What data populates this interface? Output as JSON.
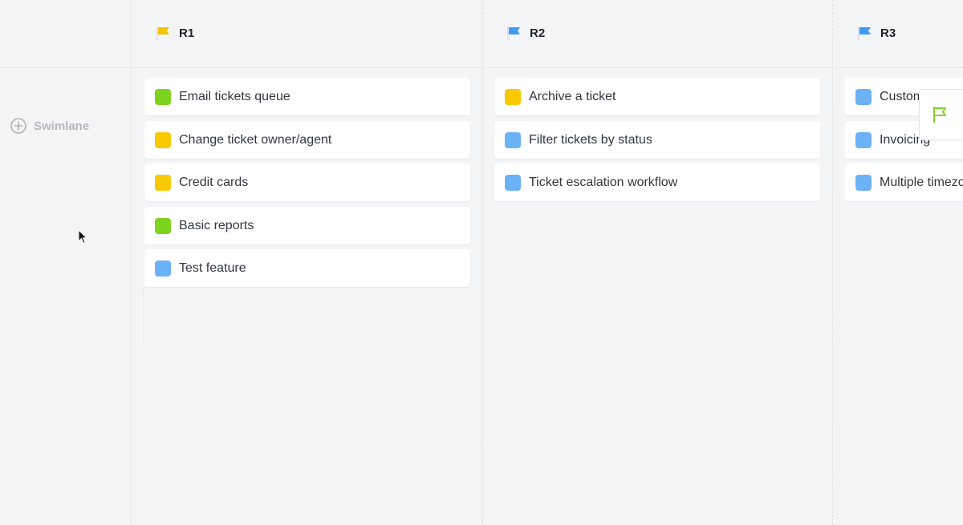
{
  "swimlane": {
    "label": "Swimlane",
    "icon": "plus-circle-icon"
  },
  "columns": [
    {
      "title": "R1",
      "flag_color": "#f5c400",
      "cards": [
        {
          "label": "Email tickets queue",
          "color": "#7ed321"
        },
        {
          "label": "Change ticket owner/agent",
          "color": "#f8c900"
        },
        {
          "label": "Credit cards",
          "color": "#f8c900"
        },
        {
          "label": "Basic reports",
          "color": "#7ed321"
        },
        {
          "label": "Test feature",
          "color": "#6cb2f7"
        }
      ]
    },
    {
      "title": "R2",
      "flag_color": "#3d9bf5",
      "cards": [
        {
          "label": "Archive a ticket",
          "color": "#f8c900"
        },
        {
          "label": "Filter tickets by status",
          "color": "#6cb2f7"
        },
        {
          "label": "Ticket escalation workflow",
          "color": "#6cb2f7"
        }
      ]
    },
    {
      "title": "R3",
      "flag_color": "#3d9bf5",
      "cards": [
        {
          "label": "Customer",
          "color": "#6cb2f7"
        },
        {
          "label": "Invoicing",
          "color": "#6cb2f7"
        },
        {
          "label": "Multiple timezones",
          "color": "#6cb2f7"
        }
      ]
    }
  ],
  "float_button": {
    "icon": "release-flag-icon",
    "color": "#7ed321"
  }
}
